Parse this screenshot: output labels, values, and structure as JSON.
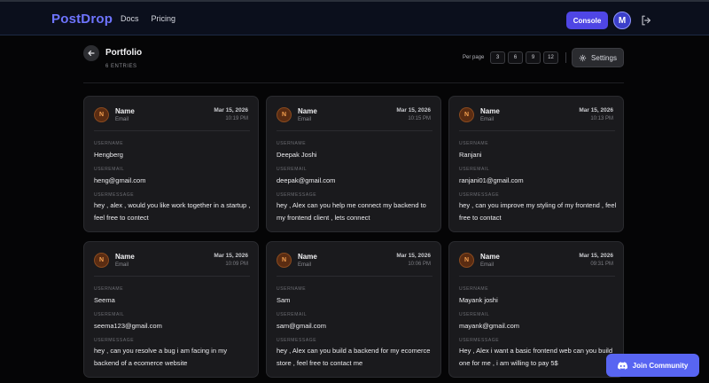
{
  "header": {
    "logo": "PostDrop",
    "nav": [
      "Docs",
      "Pricing"
    ],
    "console_label": "Console",
    "avatar_initial": "M",
    "accent": "#4f46e5"
  },
  "page": {
    "title": "Portfolio",
    "entries": "6 ENTRIES",
    "per_page_label": "Per page",
    "per_page_options": [
      "3",
      "6",
      "9",
      "12"
    ],
    "settings_label": "Settings"
  },
  "card_labels": {
    "username": "USERNAME",
    "useremail": "USEREMAIL",
    "usermessage": "USERMESSAGE"
  },
  "cards": [
    {
      "initial": "N",
      "name": "Name",
      "sub": "Email",
      "date": "Mar 15, 2026",
      "time": "10:19 PM",
      "username": "Hengberg",
      "email": "heng@gmail.com",
      "message": "hey , alex , would you like work together in a startup , feel free to contect"
    },
    {
      "initial": "N",
      "name": "Name",
      "sub": "Email",
      "date": "Mar 15, 2026",
      "time": "10:15 PM",
      "username": "Deepak Joshi",
      "email": "deepak@gmail.com",
      "message": "hey , Alex can you help me connect my backend to my frontend client , lets connect"
    },
    {
      "initial": "N",
      "name": "Name",
      "sub": "Email",
      "date": "Mar 15, 2026",
      "time": "10:13 PM",
      "username": "Ranjani",
      "email": "ranjani01@gmail.com",
      "message": "hey , can you improve my styling of my frontend , feel free to contact"
    },
    {
      "initial": "N",
      "name": "Name",
      "sub": "Email",
      "date": "Mar 15, 2026",
      "time": "10:09 PM",
      "username": "Seema",
      "email": "seema123@gmail.com",
      "message": "hey , can you resolve a bug i am facing in my backend of a ecomerce website"
    },
    {
      "initial": "N",
      "name": "Name",
      "sub": "Email",
      "date": "Mar 15, 2026",
      "time": "10:06 PM",
      "username": "Sam",
      "email": "sam@gmail.com",
      "message": "hey , Alex can you build a backend for my ecomerce store , feel free to contact me"
    },
    {
      "initial": "N",
      "name": "Name",
      "sub": "Email",
      "date": "Mar 15, 2026",
      "time": "09:31 PM",
      "username": "Mayank joshi",
      "email": "mayank@gmail.com",
      "message": "Hey , Alex i want a basic frontend web can you build one for me , i am willing to pay 5$"
    }
  ],
  "discord_label": "Join Community",
  "discord_color": "#5865f2"
}
